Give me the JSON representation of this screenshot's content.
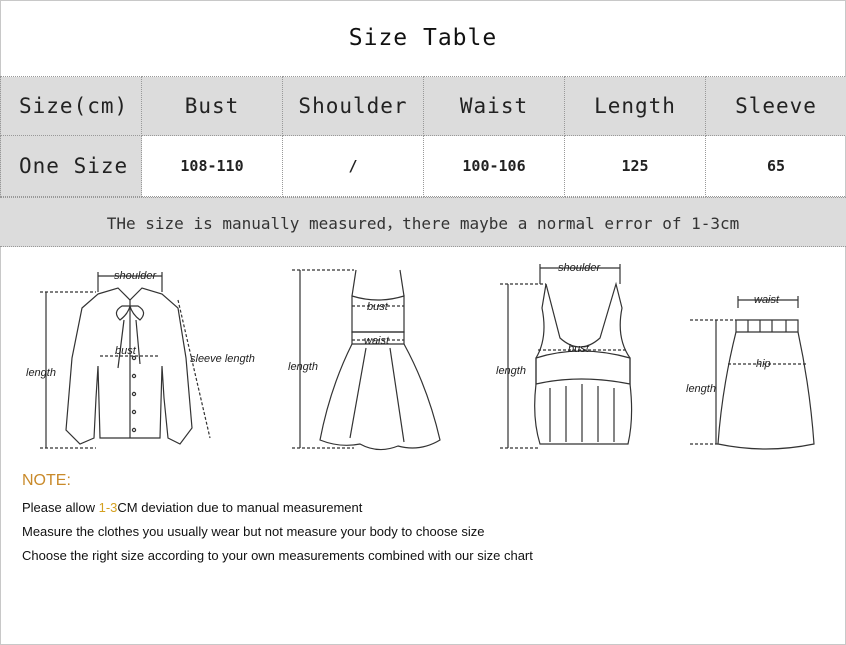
{
  "title": "Size Table",
  "table": {
    "headers": [
      "Size(cm)",
      "Bust",
      "Shoulder",
      "Waist",
      "Length",
      "Sleeve"
    ],
    "row": {
      "label": "One Size",
      "values": [
        "108-110",
        "/",
        "100-106",
        "125",
        "65"
      ]
    }
  },
  "measure_note": "THe size is manually measured，there maybe a normal error of 1-3cm",
  "diagram_labels": {
    "shirt_shoulder": "shoulder",
    "shirt_bust": "bust",
    "shirt_length": "length",
    "shirt_sleeve": "sleeve length",
    "dress_bust": "bust",
    "dress_waist": "waist",
    "dress_length": "length",
    "tank_shoulder": "shoulder",
    "tank_bust": "bust",
    "tank_length": "length",
    "skirt_waist": "waist",
    "skirt_hip": "hip",
    "skirt_length": "length"
  },
  "notes": {
    "heading": "NOTE:",
    "line1_pre": "Please allow ",
    "line1_hl": "1-3",
    "line1_post": "CM deviation due to manual measurement",
    "line2": "Measure the clothes you usually wear but not measure your body to choose size",
    "line3": "Choose the right size according to your own measurements combined with our size chart"
  },
  "colors": {
    "header_bg": "#dcdcdc",
    "note_heading": "#c98a2a",
    "highlight": "#d4a020"
  }
}
